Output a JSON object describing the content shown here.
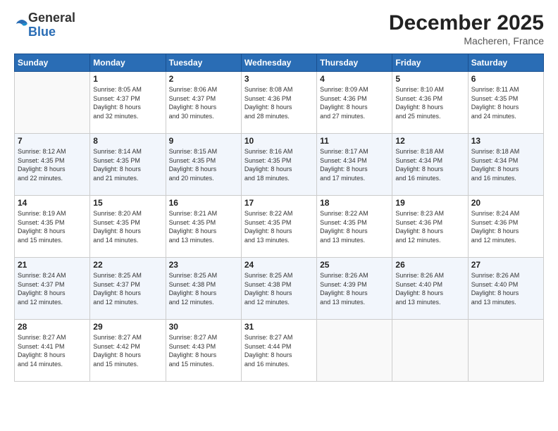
{
  "logo": {
    "general": "General",
    "blue": "Blue"
  },
  "title": "December 2025",
  "location": "Macheren, France",
  "days_header": [
    "Sunday",
    "Monday",
    "Tuesday",
    "Wednesday",
    "Thursday",
    "Friday",
    "Saturday"
  ],
  "weeks": [
    [
      {
        "day": "",
        "info": ""
      },
      {
        "day": "1",
        "info": "Sunrise: 8:05 AM\nSunset: 4:37 PM\nDaylight: 8 hours\nand 32 minutes."
      },
      {
        "day": "2",
        "info": "Sunrise: 8:06 AM\nSunset: 4:37 PM\nDaylight: 8 hours\nand 30 minutes."
      },
      {
        "day": "3",
        "info": "Sunrise: 8:08 AM\nSunset: 4:36 PM\nDaylight: 8 hours\nand 28 minutes."
      },
      {
        "day": "4",
        "info": "Sunrise: 8:09 AM\nSunset: 4:36 PM\nDaylight: 8 hours\nand 27 minutes."
      },
      {
        "day": "5",
        "info": "Sunrise: 8:10 AM\nSunset: 4:36 PM\nDaylight: 8 hours\nand 25 minutes."
      },
      {
        "day": "6",
        "info": "Sunrise: 8:11 AM\nSunset: 4:35 PM\nDaylight: 8 hours\nand 24 minutes."
      }
    ],
    [
      {
        "day": "7",
        "info": "Sunrise: 8:12 AM\nSunset: 4:35 PM\nDaylight: 8 hours\nand 22 minutes."
      },
      {
        "day": "8",
        "info": "Sunrise: 8:14 AM\nSunset: 4:35 PM\nDaylight: 8 hours\nand 21 minutes."
      },
      {
        "day": "9",
        "info": "Sunrise: 8:15 AM\nSunset: 4:35 PM\nDaylight: 8 hours\nand 20 minutes."
      },
      {
        "day": "10",
        "info": "Sunrise: 8:16 AM\nSunset: 4:35 PM\nDaylight: 8 hours\nand 18 minutes."
      },
      {
        "day": "11",
        "info": "Sunrise: 8:17 AM\nSunset: 4:34 PM\nDaylight: 8 hours\nand 17 minutes."
      },
      {
        "day": "12",
        "info": "Sunrise: 8:18 AM\nSunset: 4:34 PM\nDaylight: 8 hours\nand 16 minutes."
      },
      {
        "day": "13",
        "info": "Sunrise: 8:18 AM\nSunset: 4:34 PM\nDaylight: 8 hours\nand 16 minutes."
      }
    ],
    [
      {
        "day": "14",
        "info": "Sunrise: 8:19 AM\nSunset: 4:35 PM\nDaylight: 8 hours\nand 15 minutes."
      },
      {
        "day": "15",
        "info": "Sunrise: 8:20 AM\nSunset: 4:35 PM\nDaylight: 8 hours\nand 14 minutes."
      },
      {
        "day": "16",
        "info": "Sunrise: 8:21 AM\nSunset: 4:35 PM\nDaylight: 8 hours\nand 13 minutes."
      },
      {
        "day": "17",
        "info": "Sunrise: 8:22 AM\nSunset: 4:35 PM\nDaylight: 8 hours\nand 13 minutes."
      },
      {
        "day": "18",
        "info": "Sunrise: 8:22 AM\nSunset: 4:35 PM\nDaylight: 8 hours\nand 13 minutes."
      },
      {
        "day": "19",
        "info": "Sunrise: 8:23 AM\nSunset: 4:36 PM\nDaylight: 8 hours\nand 12 minutes."
      },
      {
        "day": "20",
        "info": "Sunrise: 8:24 AM\nSunset: 4:36 PM\nDaylight: 8 hours\nand 12 minutes."
      }
    ],
    [
      {
        "day": "21",
        "info": "Sunrise: 8:24 AM\nSunset: 4:37 PM\nDaylight: 8 hours\nand 12 minutes."
      },
      {
        "day": "22",
        "info": "Sunrise: 8:25 AM\nSunset: 4:37 PM\nDaylight: 8 hours\nand 12 minutes."
      },
      {
        "day": "23",
        "info": "Sunrise: 8:25 AM\nSunset: 4:38 PM\nDaylight: 8 hours\nand 12 minutes."
      },
      {
        "day": "24",
        "info": "Sunrise: 8:25 AM\nSunset: 4:38 PM\nDaylight: 8 hours\nand 12 minutes."
      },
      {
        "day": "25",
        "info": "Sunrise: 8:26 AM\nSunset: 4:39 PM\nDaylight: 8 hours\nand 13 minutes."
      },
      {
        "day": "26",
        "info": "Sunrise: 8:26 AM\nSunset: 4:40 PM\nDaylight: 8 hours\nand 13 minutes."
      },
      {
        "day": "27",
        "info": "Sunrise: 8:26 AM\nSunset: 4:40 PM\nDaylight: 8 hours\nand 13 minutes."
      }
    ],
    [
      {
        "day": "28",
        "info": "Sunrise: 8:27 AM\nSunset: 4:41 PM\nDaylight: 8 hours\nand 14 minutes."
      },
      {
        "day": "29",
        "info": "Sunrise: 8:27 AM\nSunset: 4:42 PM\nDaylight: 8 hours\nand 15 minutes."
      },
      {
        "day": "30",
        "info": "Sunrise: 8:27 AM\nSunset: 4:43 PM\nDaylight: 8 hours\nand 15 minutes."
      },
      {
        "day": "31",
        "info": "Sunrise: 8:27 AM\nSunset: 4:44 PM\nDaylight: 8 hours\nand 16 minutes."
      },
      {
        "day": "",
        "info": ""
      },
      {
        "day": "",
        "info": ""
      },
      {
        "day": "",
        "info": ""
      }
    ]
  ]
}
